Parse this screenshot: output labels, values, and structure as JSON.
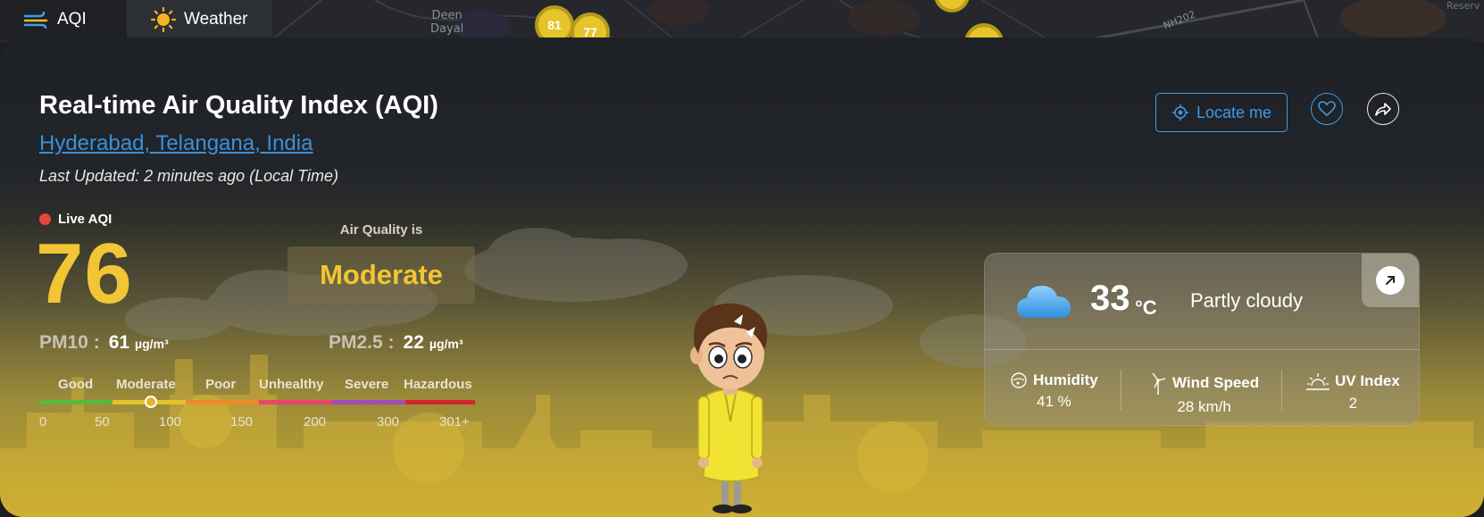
{
  "tabs": [
    {
      "label": "AQI",
      "icon": "wind-icon",
      "active": true
    },
    {
      "label": "Weather",
      "icon": "sun-icon",
      "active": false
    }
  ],
  "map": {
    "labels": [
      "Deen",
      "Dayal",
      "NH202",
      "Reserv"
    ],
    "markers": [
      "81",
      "77"
    ]
  },
  "header": {
    "title": "Real-time Air Quality Index (AQI)",
    "location": "Hyderabad, Telangana, India",
    "updated": "Last Updated: 2 minutes ago (Local Time)",
    "locate_label": "Locate me"
  },
  "aqi": {
    "live_label": "Live AQI",
    "value": "76",
    "quality_label": "Air Quality is",
    "quality": "Moderate",
    "accent": "#f1c534"
  },
  "pollutants": {
    "pm10_label": "PM10 :",
    "pm10_value": "61",
    "pm25_label": "PM2.5 :",
    "pm25_value": "22",
    "unit": "µg/m³"
  },
  "scale": {
    "categories": [
      "Good",
      "Moderate",
      "Poor",
      "Unhealthy",
      "Severe",
      "Hazardous"
    ],
    "ticks": [
      "0",
      "50",
      "100",
      "150",
      "200",
      "300",
      "301+"
    ],
    "colors": [
      "#5bb83a",
      "#e4c32e",
      "#ee8a2c",
      "#e8466b",
      "#a54bb8",
      "#d4262c"
    ],
    "marker_value": 76
  },
  "weather": {
    "temp": "33",
    "unit": "°C",
    "condition": "Partly cloudy",
    "humidity_label": "Humidity",
    "humidity_value": "41 %",
    "wind_label": "Wind Speed",
    "wind_value": "28 km/h",
    "uv_label": "UV Index",
    "uv_value": "2"
  }
}
